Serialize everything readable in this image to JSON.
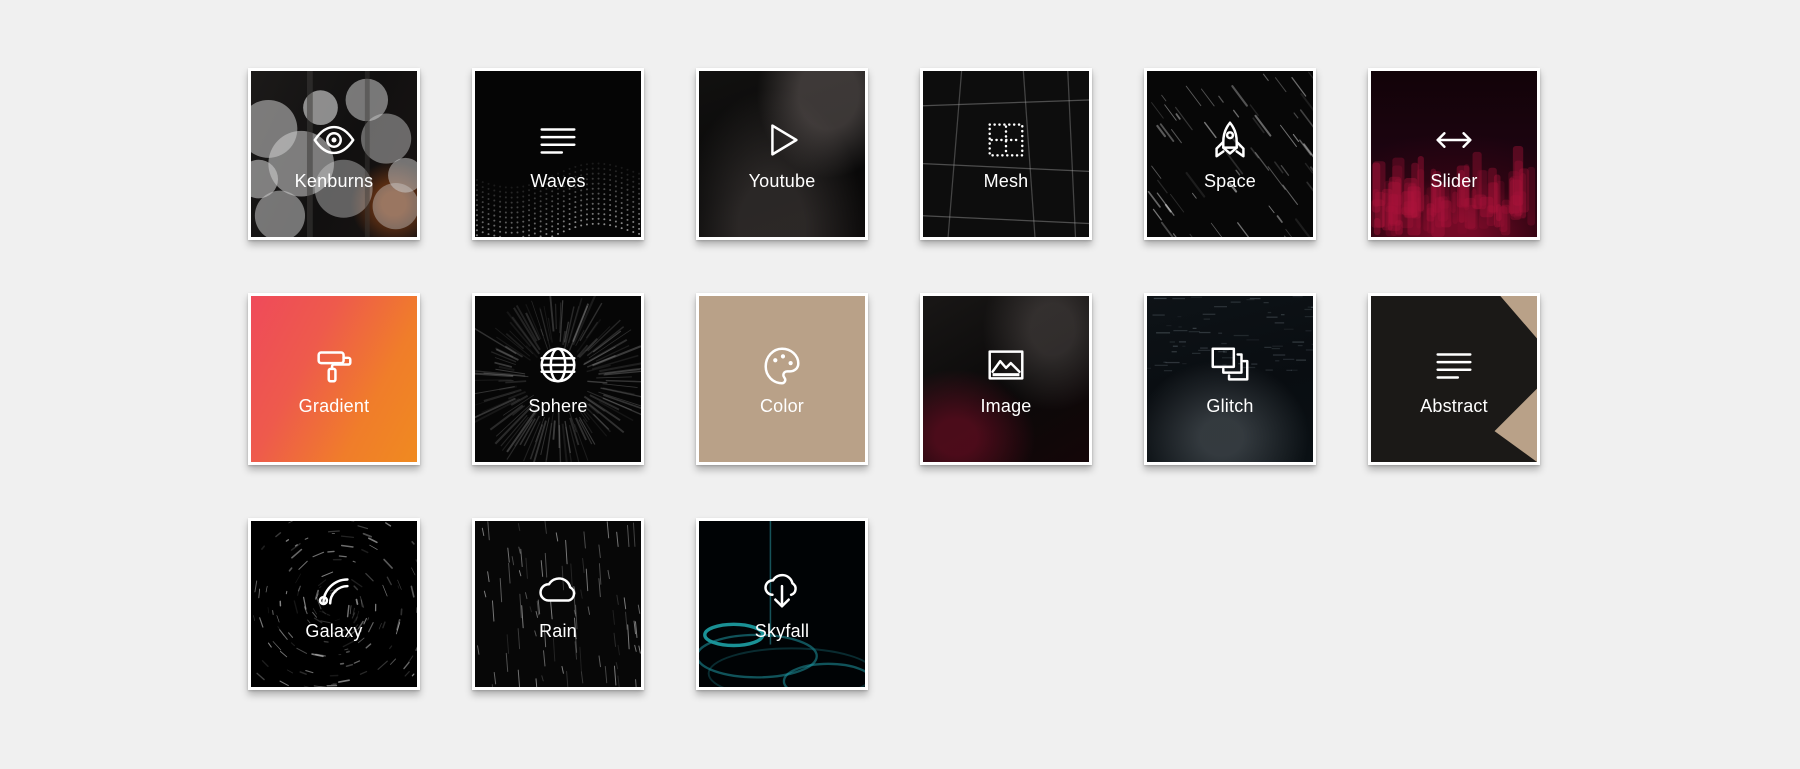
{
  "page": {
    "background_color": "#f0f0f0",
    "tile_border_color": "#ffffff",
    "label_color": "#ffffff"
  },
  "grid": {
    "columns": 6,
    "rows": 3,
    "tiles": [
      {
        "label": "Kenburns",
        "icon": "eye-icon",
        "bg_class": "bg-kenburns",
        "bg_style": "photo-bokeh-circles",
        "bg_color": "#141211"
      },
      {
        "label": "Waves",
        "icon": "lines-icon",
        "bg_class": "bg-waves",
        "bg_style": "dotted-wave-mesh",
        "bg_color": "#050505"
      },
      {
        "label": "Youtube",
        "icon": "play-triangle-icon",
        "bg_class": "bg-youtube",
        "bg_style": "dark-photo",
        "bg_color": "#0a0909"
      },
      {
        "label": "Mesh",
        "icon": "dotted-square-icon",
        "bg_class": "bg-mesh",
        "bg_style": "grid-lines",
        "bg_color": "#0d0d0d"
      },
      {
        "label": "Space",
        "icon": "rocket-icon",
        "bg_class": "bg-space",
        "bg_style": "starfield-streaks",
        "bg_color": "#070707"
      },
      {
        "label": "Slider",
        "icon": "left-right-arrow-icon",
        "bg_class": "bg-slider",
        "bg_style": "crimson-crowd",
        "bg_color": "#1c0410"
      },
      {
        "label": "Gradient",
        "icon": "paint-roller-icon",
        "bg_class": "bg-gradient",
        "bg_style": "pink-orange-gradient",
        "bg_color": "#ef4a5a"
      },
      {
        "label": "Sphere",
        "icon": "globe-icon",
        "bg_class": "bg-sphere",
        "bg_style": "radial-burst",
        "bg_color": "#060606"
      },
      {
        "label": "Color",
        "icon": "palette-icon",
        "bg_class": "bg-color",
        "bg_style": "solid-tan",
        "bg_color": "#b9a188"
      },
      {
        "label": "Image",
        "icon": "picture-icon",
        "bg_class": "bg-image",
        "bg_style": "dark-photo",
        "bg_color": "#0a0909"
      },
      {
        "label": "Glitch",
        "icon": "layers-copy-icon",
        "bg_class": "bg-glitch",
        "bg_style": "dark-blue-photo",
        "bg_color": "#0a0f13"
      },
      {
        "label": "Abstract",
        "icon": "lines-icon",
        "bg_class": "bg-abstract",
        "bg_style": "black-shape-on-tan",
        "bg_color": "#1b1917"
      },
      {
        "label": "Galaxy",
        "icon": "signal-arcs-icon",
        "bg_class": "bg-galaxy",
        "bg_style": "star-swirl",
        "bg_color": "#000000"
      },
      {
        "label": "Rain",
        "icon": "cloud-icon",
        "bg_class": "bg-rain",
        "bg_style": "rain-streaks",
        "bg_color": "#070707"
      },
      {
        "label": "Skyfall",
        "icon": "cloud-download-icon",
        "bg_class": "bg-skyfall",
        "bg_style": "teal-ripples",
        "bg_color": "#000305"
      }
    ]
  }
}
